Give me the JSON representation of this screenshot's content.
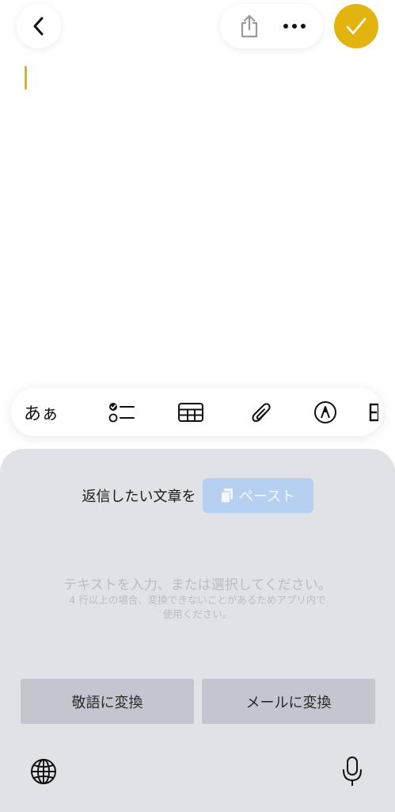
{
  "colors": {
    "accent": "#e3b40f",
    "keyboard_bg": "#e1e2e8",
    "paste_bg": "#b6d0f2",
    "convert_bg": "#c3c6ce"
  },
  "top_bar": {
    "back_icon": "chevron-left-icon",
    "share_icon": "share-icon",
    "more_icon": "ellipsis-icon",
    "done_icon": "checkmark-icon"
  },
  "toolbar": {
    "text_style_label": "あぁ",
    "items": [
      "text-style",
      "checklist-icon",
      "table-icon",
      "paperclip-icon",
      "markup-pen-icon"
    ]
  },
  "keyboard": {
    "reply_label": "返信したい文章を",
    "paste_label": "ペースト",
    "hint_main": "テキストを入力、または選択してください。",
    "hint_sub_line1": "4 行以上の場合、変換できないことがあるためアプリ内で",
    "hint_sub_line2": "使用ください。",
    "keigo_button": "敬語に変換",
    "mail_button": "メールに変換",
    "globe_icon": "globe-icon",
    "mic_icon": "microphone-icon"
  }
}
